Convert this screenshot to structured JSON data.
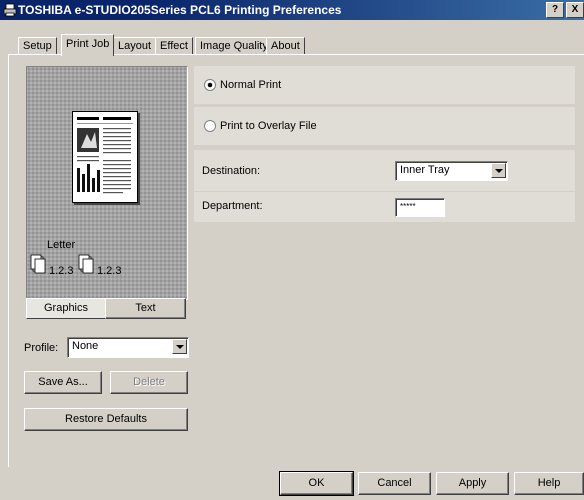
{
  "window": {
    "title": "TOSHIBA e-STUDIO205Series PCL6 Printing Preferences",
    "help_label": "?",
    "close_label": "X"
  },
  "tabs": [
    {
      "label": "Setup",
      "active": false
    },
    {
      "label": "Print Job",
      "active": true
    },
    {
      "label": "Layout",
      "active": false
    },
    {
      "label": "Effect",
      "active": false
    },
    {
      "label": "Image Quality",
      "active": false
    },
    {
      "label": "About",
      "active": false
    }
  ],
  "preview": {
    "paper_size": "Letter",
    "copies_label_1": "1.2.3",
    "copies_label_2": "1.2.3"
  },
  "preview_tabs": {
    "graphics": "Graphics",
    "text": "Text"
  },
  "profile": {
    "label": "Profile:",
    "value": "None",
    "save_as": "Save As...",
    "delete": "Delete",
    "restore_defaults": "Restore Defaults"
  },
  "print_job": {
    "normal_print": "Normal Print",
    "normal_print_selected": true,
    "print_to_overlay": "Print to Overlay File",
    "print_to_overlay_selected": false,
    "destination_label": "Destination:",
    "destination_value": "Inner Tray",
    "department_label": "Department:",
    "department_value": "*****"
  },
  "footer": {
    "ok": "OK",
    "cancel": "Cancel",
    "apply": "Apply",
    "help": "Help"
  }
}
